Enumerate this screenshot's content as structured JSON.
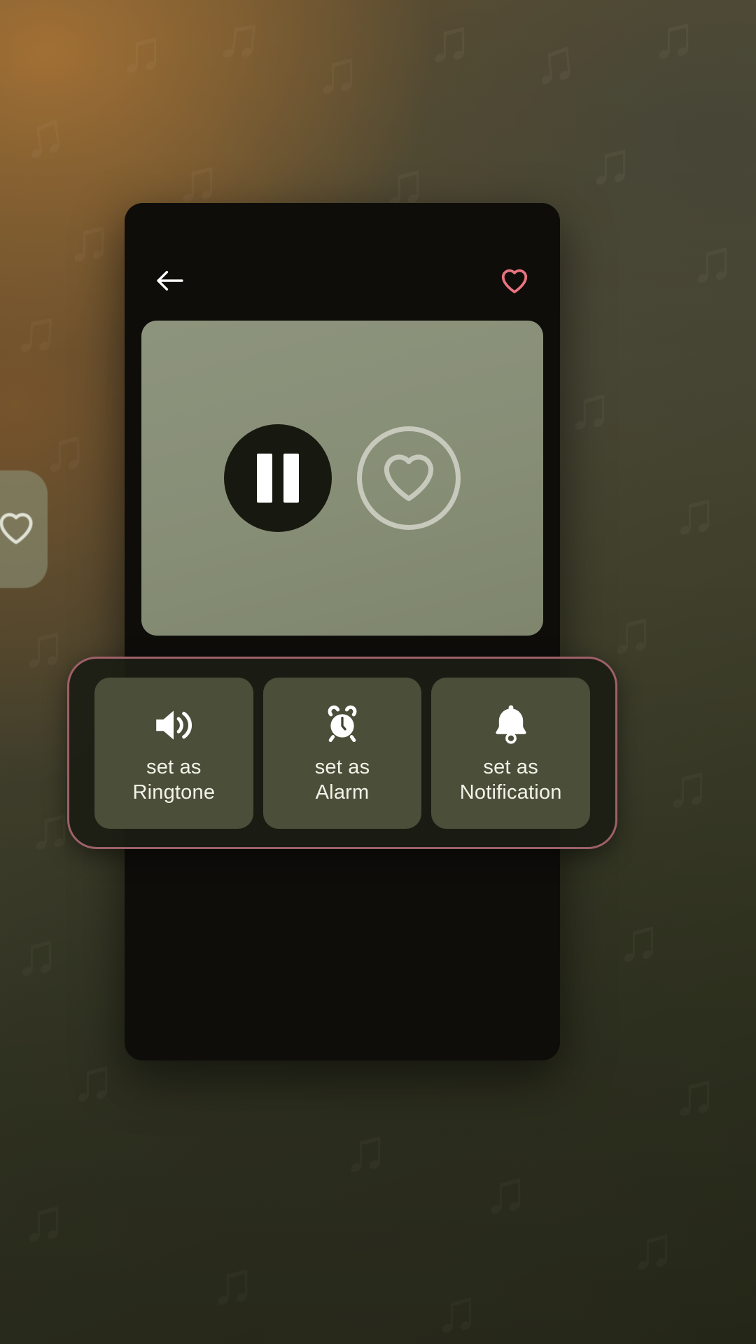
{
  "background": {
    "note_glyph": "♫",
    "note_glyph_alt": "♪",
    "gradient_warm": "#b07a3a",
    "gradient_olive": "#4e4d3c"
  },
  "left_peek_card": {
    "icon": "heart-outline-icon"
  },
  "dialog": {
    "header": {
      "back_icon": "arrow-left-icon",
      "favorite_icon": "heart-outline-icon",
      "favorite_color": "#e8737f"
    },
    "artwork": {
      "background_color": "#878e76",
      "pause_button": {
        "icon": "pause-icon",
        "color": "#17180f"
      },
      "like_button": {
        "icon": "heart-outline-circle-icon",
        "color": "#c7c9bc"
      }
    },
    "action_bar": {
      "highlight_color": "#9e6068",
      "items": [
        {
          "icon": "volume-up-icon",
          "label": "set as\nRingtone"
        },
        {
          "icon": "alarm-clock-icon",
          "label": "set as\nAlarm"
        },
        {
          "icon": "bell-icon",
          "label": "set as\nNotification"
        }
      ]
    }
  }
}
